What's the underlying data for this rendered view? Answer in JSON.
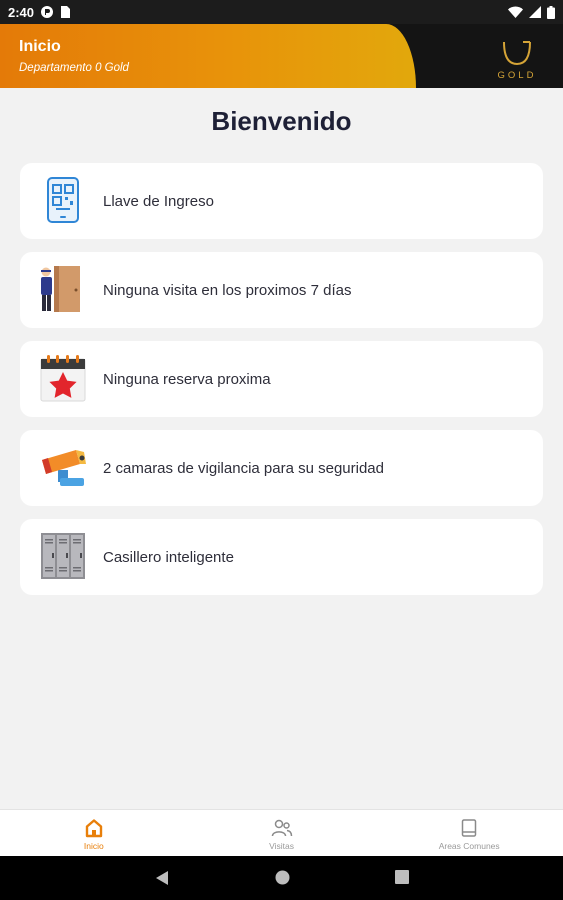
{
  "status_bar": {
    "time": "2:40"
  },
  "header": {
    "title": "Inicio",
    "subtitle": "Departamento 0 Gold",
    "logo_text": "GOLD"
  },
  "welcome": "Bienvenido",
  "cards": [
    {
      "label": "Llave de Ingreso",
      "icon": "qr-phone-icon"
    },
    {
      "label": "Ninguna visita en los proximos 7 días",
      "icon": "visitor-door-icon"
    },
    {
      "label": "Ninguna reserva proxima",
      "icon": "calendar-star-icon"
    },
    {
      "label": "2 camaras de vigilancia para su seguridad",
      "icon": "security-camera-icon"
    },
    {
      "label": "Casillero inteligente",
      "icon": "locker-icon"
    }
  ],
  "bottom_nav": [
    {
      "label": "Inicio",
      "icon": "home-icon",
      "active": true
    },
    {
      "label": "Visitas",
      "icon": "people-icon",
      "active": false
    },
    {
      "label": "Areas Comunes",
      "icon": "book-icon",
      "active": false
    }
  ],
  "colors": {
    "accent": "#e87f0a",
    "header_dark": "#141414",
    "text_dark": "#1e2036",
    "background": "#f2f2f2"
  }
}
